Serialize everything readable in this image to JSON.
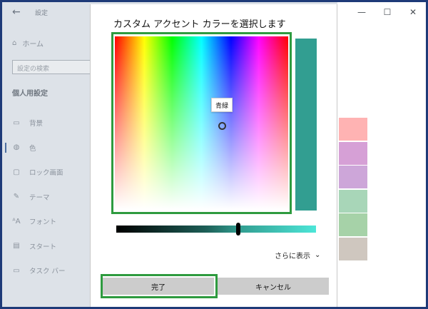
{
  "settings": {
    "title": "設定",
    "home": "ホーム",
    "search_placeholder": "設定の検索",
    "section": "個人用設定",
    "nav": [
      {
        "label": "背景",
        "icon": "image-icon"
      },
      {
        "label": "色",
        "icon": "palette-icon"
      },
      {
        "label": "ロック画面",
        "icon": "lock-screen-icon"
      },
      {
        "label": "テーマ",
        "icon": "theme-icon"
      },
      {
        "label": "フォント",
        "icon": "font-icon"
      },
      {
        "label": "スタート",
        "icon": "start-icon"
      },
      {
        "label": "タスク バー",
        "icon": "taskbar-icon"
      }
    ],
    "swatch_colors": [
      "#ffb3b3",
      "#d6a0d6",
      "#cda6d9",
      "#a8d6b8",
      "#a6d2a8",
      "#cfc7bf"
    ]
  },
  "dialog": {
    "title": "カスタム アクセント カラーを選択します",
    "tooltip": "青緑",
    "preview_color": "#329e91",
    "more_label": "さらに表示",
    "done_label": "完了",
    "cancel_label": "キャンセル",
    "highlight_color": "#2e9b3f"
  }
}
